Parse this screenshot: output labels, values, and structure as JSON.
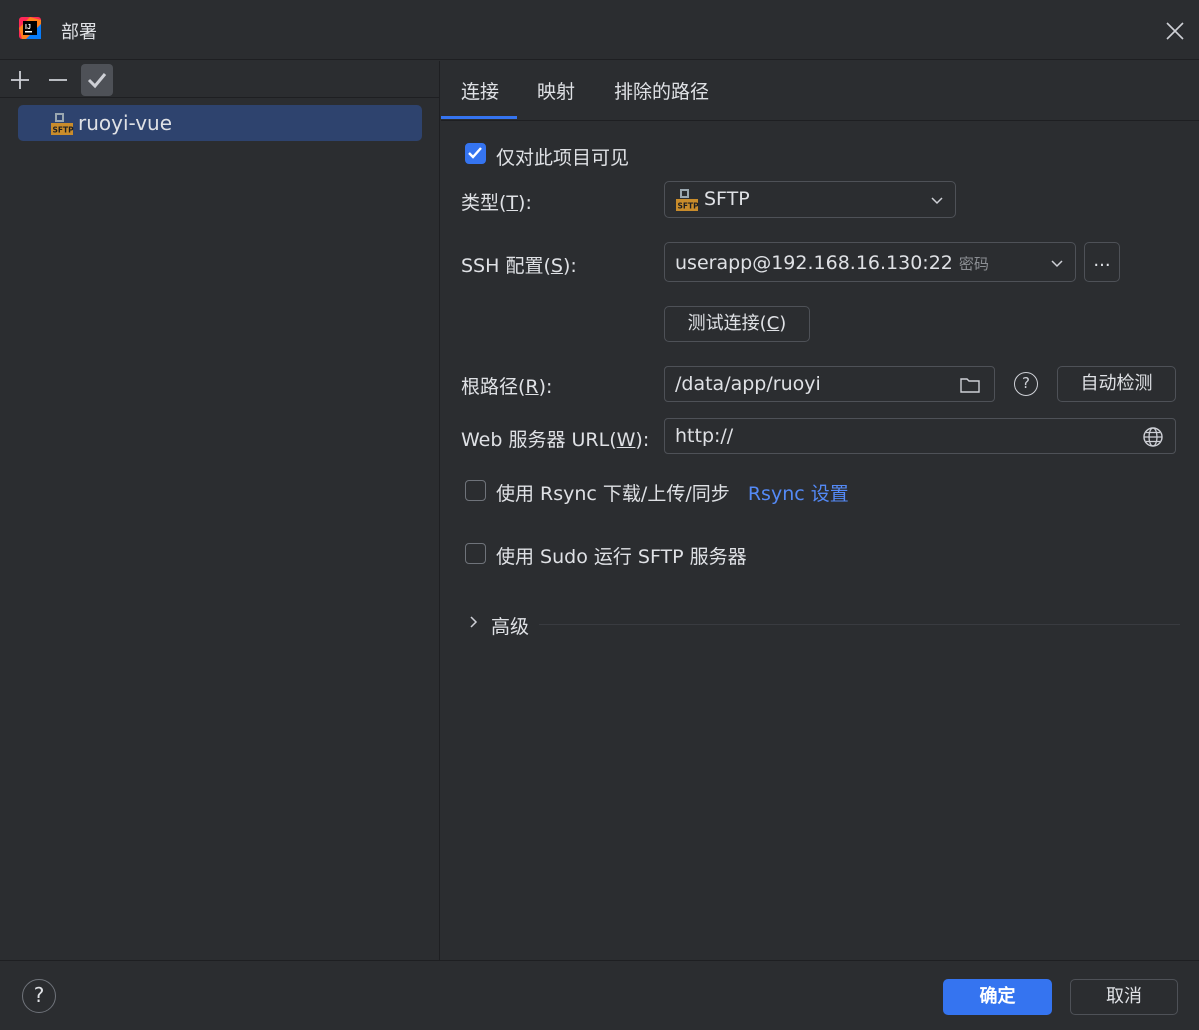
{
  "window": {
    "title": "部署"
  },
  "left_panel": {
    "servers": [
      {
        "name": "ruoyi-vue",
        "type_icon": "sftp-icon"
      }
    ]
  },
  "tabs": [
    {
      "label": "连接",
      "selected": true
    },
    {
      "label": "映射",
      "selected": false
    },
    {
      "label": "排除的路径",
      "selected": false
    }
  ],
  "connection": {
    "visible_only_project": {
      "label": "仅对此项目可见",
      "checked": true
    },
    "type": {
      "label_prefix": "类型(",
      "mnemonic": "T",
      "label_suffix": "):",
      "value": "SFTP"
    },
    "ssh": {
      "label_prefix": "SSH 配置(",
      "mnemonic": "S",
      "label_suffix": "):",
      "value": "userapp@192.168.16.130:22",
      "auth": "密码",
      "more_label": "..."
    },
    "test_button": {
      "label_prefix": "测试连接(",
      "mnemonic": "C",
      "label_suffix": ")"
    },
    "root_path": {
      "label_prefix": "根路径(",
      "mnemonic": "R",
      "label_suffix": "):",
      "value": "/data/app/ruoyi",
      "autodetect_label": "自动检测"
    },
    "web_url": {
      "label_prefix": "Web 服务器 URL(",
      "mnemonic": "W",
      "label_suffix": "):",
      "value": "http://"
    },
    "rsync": {
      "label": "使用 Rsync 下载/上传/同步",
      "checked": false,
      "link": "Rsync 设置"
    },
    "sudo": {
      "label": "使用 Sudo 运行 SFTP 服务器",
      "checked": false
    },
    "advanced": {
      "label": "高级"
    }
  },
  "footer": {
    "help": "?",
    "ok": "确定",
    "cancel": "取消"
  },
  "colors": {
    "accent": "#3574f0",
    "selection": "#2e436e",
    "link": "#548af7",
    "background": "#2b2d30"
  }
}
